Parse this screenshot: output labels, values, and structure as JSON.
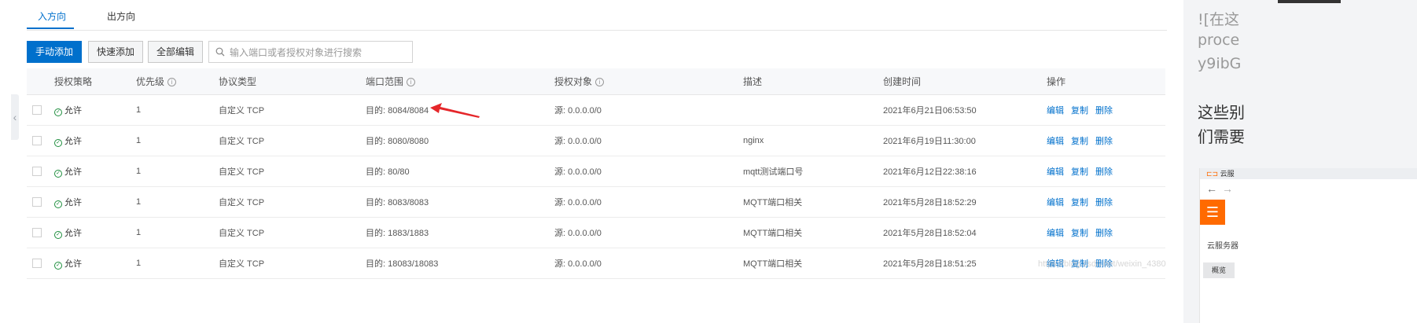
{
  "tabs": [
    {
      "label": "入方向",
      "active": true
    },
    {
      "label": "出方向",
      "active": false
    }
  ],
  "toolbar": {
    "manual_add": "手动添加",
    "quick_add": "快速添加",
    "edit_all": "全部编辑",
    "search_placeholder": "输入端口或者授权对象进行搜索"
  },
  "table": {
    "headers": {
      "policy": "授权策略",
      "priority": "优先级",
      "protocol": "协议类型",
      "port": "端口范围",
      "target": "授权对象",
      "description": "描述",
      "created": "创建时间",
      "actions": "操作"
    },
    "rows": [
      {
        "policy": "允许",
        "priority": "1",
        "protocol": "自定义 TCP",
        "port": "目的: 8084/8084",
        "target": "源: 0.0.0.0/0",
        "description": "",
        "created": "2021年6月21日06:53:50"
      },
      {
        "policy": "允许",
        "priority": "1",
        "protocol": "自定义 TCP",
        "port": "目的: 8080/8080",
        "target": "源: 0.0.0.0/0",
        "description": "nginx",
        "created": "2021年6月19日11:30:00"
      },
      {
        "policy": "允许",
        "priority": "1",
        "protocol": "自定义 TCP",
        "port": "目的: 80/80",
        "target": "源: 0.0.0.0/0",
        "description": "mqtt测试端口号",
        "created": "2021年6月12日22:38:16"
      },
      {
        "policy": "允许",
        "priority": "1",
        "protocol": "自定义 TCP",
        "port": "目的: 8083/8083",
        "target": "源: 0.0.0.0/0",
        "description": "MQTT端口相关",
        "created": "2021年5月28日18:52:29"
      },
      {
        "policy": "允许",
        "priority": "1",
        "protocol": "自定义 TCP",
        "port": "目的: 1883/1883",
        "target": "源: 0.0.0.0/0",
        "description": "MQTT端口相关",
        "created": "2021年5月28日18:52:04"
      },
      {
        "policy": "允许",
        "priority": "1",
        "protocol": "自定义 TCP",
        "port": "目的: 18083/18083",
        "target": "源: 0.0.0.0/0",
        "description": "MQTT端口相关",
        "created": "2021年5月28日18:51:25"
      }
    ],
    "actions": {
      "edit": "编辑",
      "copy": "复制",
      "delete": "删除"
    }
  },
  "colors": {
    "accent": "#0070cc",
    "allow": "#1e8e3e",
    "annotation_arrow": "#e5262a",
    "mini_brand": "#ff6a00"
  },
  "icons": {
    "search": "search-icon",
    "info": "info-icon",
    "allow": "check-circle-icon",
    "collapse": "chevron-left-icon",
    "menu": "hamburger-icon"
  },
  "right_panel": {
    "md_line1": "![在这",
    "md_line2": "proce",
    "md_line3": "y9ibG",
    "para_line1": "这些别",
    "para_line2": "们需要",
    "mini": {
      "tab_title": "云服",
      "back": "←",
      "forward": "→",
      "menu_glyph": "☰",
      "label1": "云服务器",
      "label2": "概览"
    }
  },
  "watermark": "https://blog.csdn.net/weixin_4380"
}
